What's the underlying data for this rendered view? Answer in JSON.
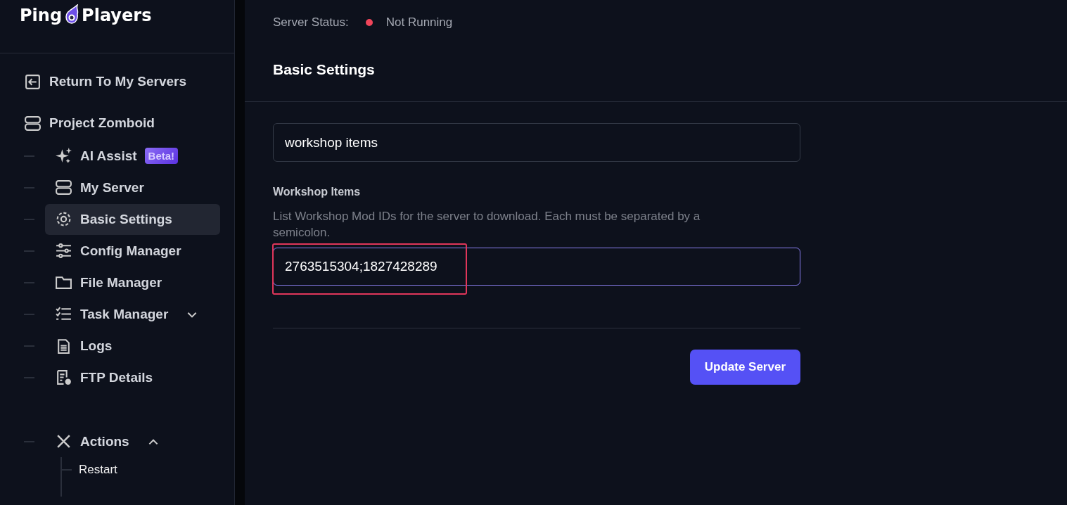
{
  "logo": {
    "left": "Ping",
    "right": "Players"
  },
  "sidebar": {
    "back_link": "Return To My Servers",
    "server": "Project Zomboid",
    "items": [
      {
        "label": "AI Assist",
        "badge": "Beta!",
        "selected": false
      },
      {
        "label": "My Server",
        "selected": false
      },
      {
        "label": "Basic Settings",
        "selected": true
      },
      {
        "label": "Config Manager",
        "selected": false
      },
      {
        "label": "File Manager",
        "selected": false
      },
      {
        "label": "Task Manager",
        "selected": false,
        "expanded": false
      },
      {
        "label": "Logs",
        "selected": false
      },
      {
        "label": "FTP Details",
        "selected": false
      },
      {
        "label": "Actions",
        "selected": false,
        "expanded": true,
        "children": [
          {
            "label": "Restart"
          }
        ]
      }
    ]
  },
  "status": {
    "label": "Server Status:",
    "value": "Not Running",
    "color": "#f0455a"
  },
  "section_title": "Basic Settings",
  "search": {
    "value": "workshop items"
  },
  "setting": {
    "label": "Workshop Items",
    "help": "List Workshop Mod IDs for the server to download. Each must be separated by a semicolon.",
    "value": "2763515304;1827428289",
    "highlighted": true
  },
  "buttons": [
    "Update Server"
  ]
}
